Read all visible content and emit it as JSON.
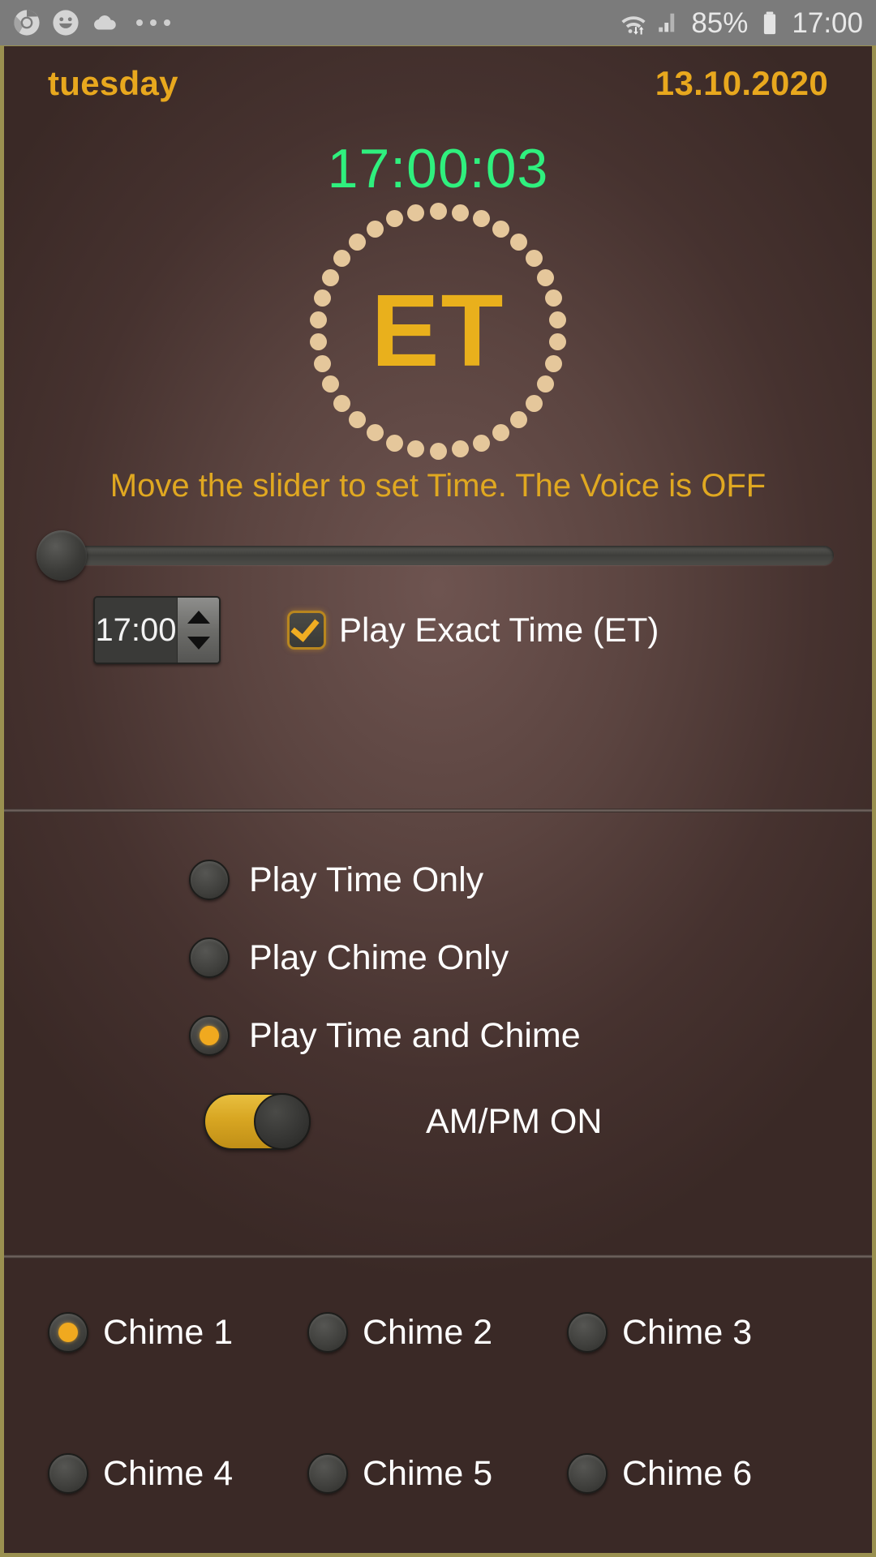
{
  "statusbar": {
    "icons": [
      "chrome-icon",
      "smiley-icon",
      "cloud-icon",
      "overflow-dots-icon"
    ],
    "wifi_icon": "wifi-data-icon",
    "signal_icon": "cell-signal-icon",
    "battery_percent": "85%",
    "battery_icon": "battery-icon",
    "clock": "17:00"
  },
  "header": {
    "weekday": "tuesday",
    "date": "13.10.2020",
    "clock": "17:00:03"
  },
  "logo": {
    "text": "ET"
  },
  "hint": {
    "text": "Move the slider to set Time. The Voice is OFF"
  },
  "slider": {
    "value": 0,
    "min": 0,
    "max": 100
  },
  "spinner": {
    "value": "17:00",
    "up_icon": "triangle-up-icon",
    "down_icon": "triangle-down-icon"
  },
  "exact_time_checkbox": {
    "label": "Play Exact Time  (ET)",
    "checked": true,
    "check_icon": "checkmark-icon"
  },
  "play_mode": {
    "options": [
      {
        "label": "Play Time Only",
        "selected": false
      },
      {
        "label": "Play Chime Only",
        "selected": false
      },
      {
        "label": "Play Time and Chime",
        "selected": true
      }
    ]
  },
  "ampm_toggle": {
    "label": "AM/PM ON",
    "on": true
  },
  "chimes": {
    "rows": [
      [
        {
          "label": "Chime 1",
          "selected": true
        },
        {
          "label": "Chime 2",
          "selected": false
        },
        {
          "label": "Chime 3",
          "selected": false
        }
      ],
      [
        {
          "label": "Chime 4",
          "selected": false
        },
        {
          "label": "Chime 5",
          "selected": false
        },
        {
          "label": "Chime 6",
          "selected": false
        }
      ]
    ]
  },
  "colors": {
    "accent_gold": "#e8a81e",
    "clock_green": "#2ff07e",
    "background": "#46322f",
    "border": "#9a9050",
    "logo_dot": "#e5c79b"
  }
}
